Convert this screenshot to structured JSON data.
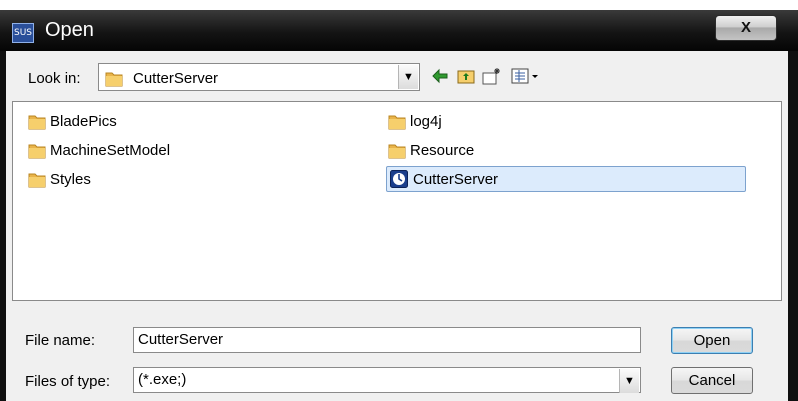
{
  "window": {
    "title": "Open",
    "app_icon_text": "SUS",
    "close_label": "X"
  },
  "lookin": {
    "label": "Look in:",
    "value": "CutterServer"
  },
  "toolbar": {
    "back_icon": "back-arrow-icon",
    "up_icon": "up-folder-icon",
    "new_folder_icon": "new-folder-icon",
    "view_menu_icon": "view-menu-icon"
  },
  "files": [
    {
      "name": "BladePics",
      "type": "folder"
    },
    {
      "name": "MachineSetModel",
      "type": "folder"
    },
    {
      "name": "Styles",
      "type": "folder"
    },
    {
      "name": "log4j",
      "type": "folder"
    },
    {
      "name": "Resource",
      "type": "folder"
    },
    {
      "name": "CutterServer",
      "type": "application",
      "selected": true
    }
  ],
  "filename": {
    "label": "File name:",
    "value": "CutterServer"
  },
  "filetype": {
    "label": "Files of type:",
    "value": "(*.exe;)"
  },
  "buttons": {
    "open": "Open",
    "cancel": "Cancel"
  },
  "colors": {
    "selection": "#dcebfc",
    "selection_border": "#7da2ce",
    "folder": "#e9b44a"
  }
}
